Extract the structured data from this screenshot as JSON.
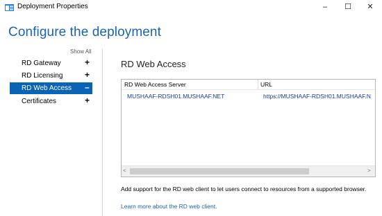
{
  "window": {
    "title": "Deployment Properties",
    "minimize": "–",
    "maximize": "☐",
    "close": "✕",
    "app_icon": "server-folder-icon"
  },
  "page": {
    "heading": "Configure the deployment"
  },
  "sidebar": {
    "show_all": "Show All",
    "items": [
      {
        "label": "RD Gateway",
        "toggle": "+",
        "selected": false
      },
      {
        "label": "RD Licensing",
        "toggle": "+",
        "selected": false
      },
      {
        "label": "RD Web Access",
        "toggle": "–",
        "selected": true
      },
      {
        "label": "Certificates",
        "toggle": "+",
        "selected": false
      }
    ]
  },
  "main": {
    "section_title": "RD Web Access",
    "table": {
      "columns": [
        "RD Web Access Server",
        "URL"
      ],
      "rows": [
        {
          "server": "MUSHAAF-RDSH01.MUSHAAF.NET",
          "url": "https://MUSHAAF-RDSH01.MUSHAAF.N"
        }
      ],
      "scroll_left": "<",
      "scroll_right": ">"
    },
    "description": "Add support for the RD web client to let users connect to resources from a supported browser.",
    "learn_more": "Learn more about the RD web client."
  },
  "colors": {
    "accent": "#1a64b0",
    "selected_bg": "#0a64b6"
  }
}
